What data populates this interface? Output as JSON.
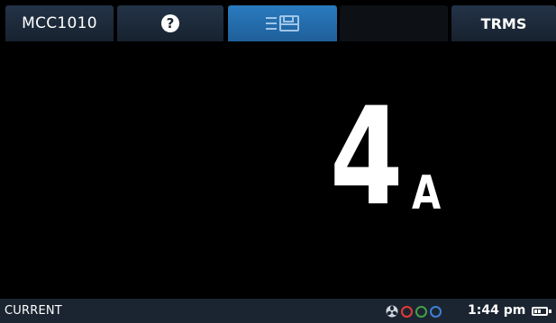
{
  "header": {
    "model_label": "MCC1010",
    "help_icon": "question-mark-icon",
    "menu_icon": "menu-save-icon",
    "mode_label": "TRMS"
  },
  "reading": {
    "value": "4",
    "unit": "A"
  },
  "status": {
    "mode": "CURRENT",
    "time": "1:44 pm",
    "icons": [
      "fan-icon",
      "red-ring-icon",
      "green-ring-icon",
      "blue-ring-icon",
      "battery-icon"
    ]
  },
  "colors": {
    "tab_dark": "#1b2633",
    "tab_active": "#2a7bbf",
    "status_bar": "#1b2531",
    "ring_red": "#e53935",
    "ring_green": "#43a047",
    "ring_blue": "#3f7fd6"
  }
}
